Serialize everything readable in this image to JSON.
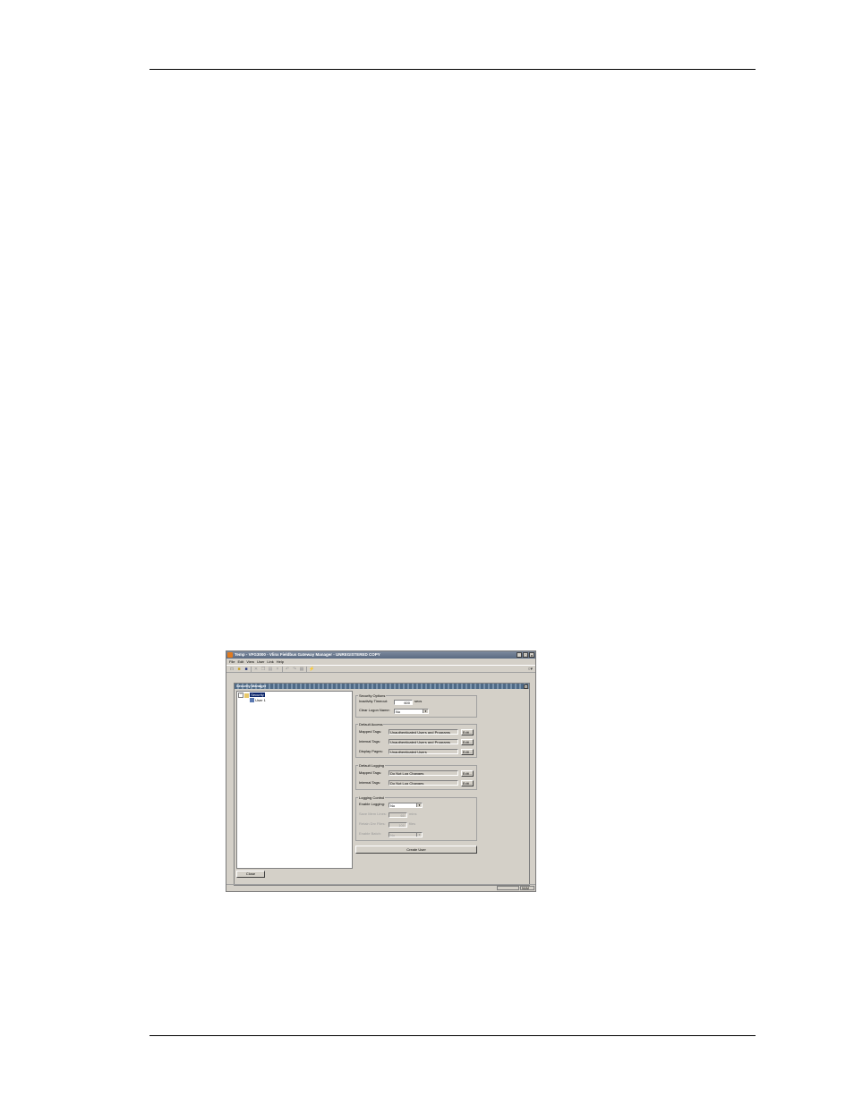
{
  "window": {
    "title": "Temp - VFG3000 - Vlinx Fieldbus Gateway Manager - UNREGISTERED COPY",
    "controls": [
      "_",
      "□",
      "×"
    ]
  },
  "menu": [
    "File",
    "Edit",
    "View",
    "User",
    "Link",
    "Help"
  ],
  "toolbar_icons": [
    "new-icon",
    "open-icon",
    "save-icon",
    "cut-icon",
    "copy-icon",
    "paste-icon",
    "delete-icon",
    "undo-icon",
    "redo-icon",
    "print-icon",
    "lightning-icon",
    "help-icon"
  ],
  "mdi": {
    "title": "Security Manager",
    "close": "×"
  },
  "tree": {
    "root": "Security",
    "children": [
      "User 1"
    ]
  },
  "security_options": {
    "label": "Security Options",
    "inactivity_label": "Inactivity Timeout:",
    "inactivity_value": "600",
    "inactivity_unit": "secs",
    "clear_logon_label": "Clear Logon Name:",
    "clear_logon_value": "No"
  },
  "default_access": {
    "label": "Default Access",
    "mapped_label": "Mapped Tags:",
    "mapped_value": "Unauthenticated Users and Programs",
    "internal_label": "Internal Tags:",
    "internal_value": "Unauthenticated Users and Programs",
    "display_label": "Display Pages:",
    "display_value": "Unauthenticated Users",
    "edit": "Edit..."
  },
  "default_logging": {
    "label": "Default Logging",
    "mapped_label": "Mapped Tags:",
    "mapped_value": "Do Not Log Changes",
    "internal_label": "Internal Tags:",
    "internal_value": "Do Not Log Changes",
    "edit": "Edit..."
  },
  "logging_control": {
    "label": "Logging Control",
    "enable_label": "Enable Logging:",
    "enable_value": "No",
    "row2_label": "Save Mem Lines:",
    "row2_value": "60",
    "row2_unit": "mins",
    "row3_label": "Retain Drv Files:",
    "row3_value": "100",
    "row3_unit": "files",
    "row4_label": "Enable Batch:",
    "row4_value": "No"
  },
  "buttons": {
    "create_user": "Create User",
    "close": "Close"
  },
  "status": {
    "panel1": "",
    "panel2": "NUM"
  }
}
